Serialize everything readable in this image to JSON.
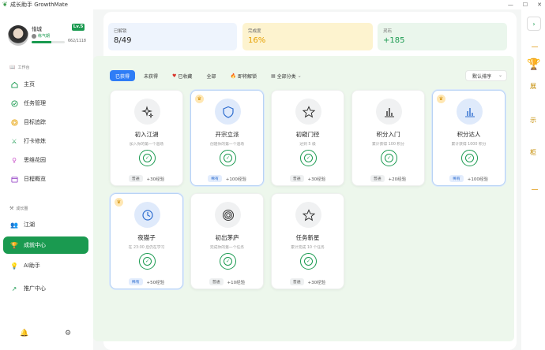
{
  "window": {
    "title": "成长助手 GrowthMate"
  },
  "user": {
    "name": "惜城",
    "level": "Lv.5",
    "rank": "练气期",
    "xp_text": "662/1118",
    "xp_fraction": 0.59
  },
  "nav": {
    "section_work": "工作台",
    "items": [
      {
        "label": "主页",
        "icon": "home-icon"
      },
      {
        "label": "任务管理",
        "icon": "check-circle-icon"
      },
      {
        "label": "目标追踪",
        "icon": "target-icon"
      },
      {
        "label": "打卡修炼",
        "icon": "sword-icon"
      },
      {
        "label": "思维花园",
        "icon": "bulb-icon"
      },
      {
        "label": "日程概览",
        "icon": "calendar-icon"
      }
    ],
    "section_growth": "成长圈",
    "items2": [
      {
        "label": "江湖",
        "icon": "people-icon"
      },
      {
        "label": "成就中心",
        "icon": "trophy-icon",
        "active": true
      },
      {
        "label": "AI助手",
        "icon": "bulb-icon"
      }
    ],
    "promo": "推广中心"
  },
  "stats": {
    "unlocked": {
      "label": "已解锁",
      "value": "8/49",
      "color": "#eef4fd"
    },
    "completion": {
      "label": "完成度",
      "value": "16%",
      "color": "#fdf3cf"
    },
    "spirit": {
      "label": "灵石",
      "value": "+185",
      "color": "#eaf6ec"
    }
  },
  "filters": [
    "已获得",
    "未获得",
    "已收藏",
    "全部",
    "即将解锁",
    "全部分类"
  ],
  "sort": "默认排序",
  "cards": [
    {
      "title": "初入江湖",
      "desc": "加入你的第一个道场",
      "tag": "普通",
      "exp": "+30经验",
      "rare": false,
      "icon": "sparkle-icon"
    },
    {
      "title": "开宗立派",
      "desc": "创建你的第一个道场",
      "tag": "稀有",
      "exp": "+100经验",
      "rare": true,
      "icon": "shield-icon"
    },
    {
      "title": "初窥门径",
      "desc": "达到 5 级",
      "tag": "普通",
      "exp": "+30经验",
      "rare": false,
      "icon": "star-icon"
    },
    {
      "title": "积分入门",
      "desc": "累计获得 100 积分",
      "tag": "普通",
      "exp": "+20经验",
      "rare": false,
      "icon": "bar-chart-icon"
    },
    {
      "title": "积分达人",
      "desc": "累计获得 1000 积分",
      "tag": "稀有",
      "exp": "+100经验",
      "rare": true,
      "icon": "bar-chart-icon"
    },
    {
      "title": "夜猫子",
      "desc": "在 23:00 后仍在学习",
      "tag": "稀有",
      "exp": "+50经验",
      "rare": true,
      "icon": "clock-icon"
    },
    {
      "title": "初出茅庐",
      "desc": "完成你的第一个任务",
      "tag": "普通",
      "exp": "+10经验",
      "rare": false,
      "icon": "target-icon"
    },
    {
      "title": "任务新星",
      "desc": "累计完成 10 个任务",
      "tag": "普通",
      "exp": "+30经验",
      "rare": false,
      "icon": "star-icon"
    }
  ],
  "rail": {
    "chars": [
      "展",
      "示",
      "柜"
    ]
  }
}
